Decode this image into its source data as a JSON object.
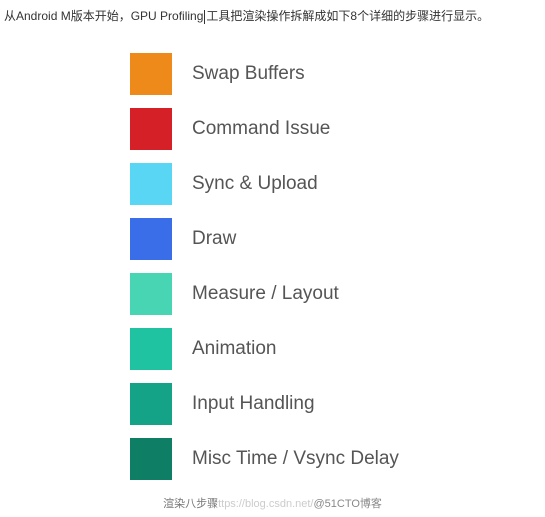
{
  "header": {
    "text_before_cursor": "从Android M版本开始，GPU Profiling",
    "text_after_cursor": "工具把渲染操作拆解成如下8个详细的步骤进行显示。"
  },
  "chart_data": {
    "type": "table",
    "title": "GPU Profiling Rendering Steps Legend",
    "series": [
      {
        "name": "Swap Buffers",
        "color": "#ed8a19"
      },
      {
        "name": "Command Issue",
        "color": "#d62027"
      },
      {
        "name": "Sync & Upload",
        "color": "#58d6f3"
      },
      {
        "name": "Draw",
        "color": "#3a6ee8"
      },
      {
        "name": "Measure / Layout",
        "color": "#48d5b3"
      },
      {
        "name": "Animation",
        "color": "#1fc2a1"
      },
      {
        "name": "Input Handling",
        "color": "#14a387"
      },
      {
        "name": "Misc Time / Vsync Delay",
        "color": "#0e7e65"
      }
    ]
  },
  "footer": {
    "caption": "渲染八步骤",
    "watermark": "ttps://blog.csdn.net/",
    "brand": "@51CTO博客"
  }
}
